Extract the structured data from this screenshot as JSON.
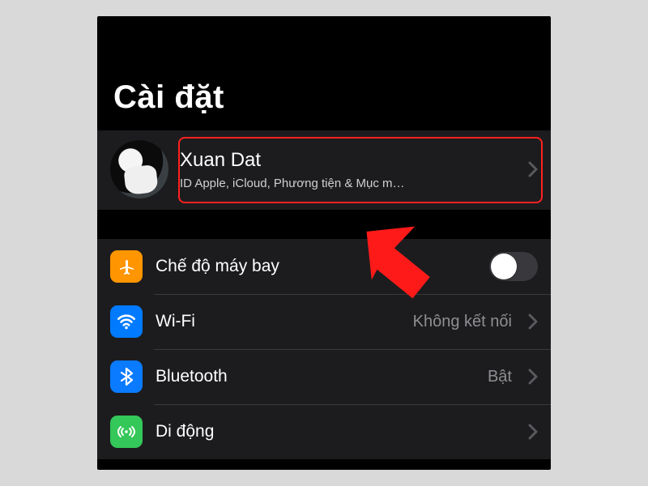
{
  "title": "Cài đặt",
  "profile": {
    "name": "Xuan Dat",
    "subtitle": "ID Apple, iCloud, Phương tiện & Mục m…"
  },
  "rows": {
    "airplane": {
      "label": "Chế độ máy bay",
      "switch_on": false
    },
    "wifi": {
      "label": "Wi-Fi",
      "detail": "Không kết nối"
    },
    "bluetooth": {
      "label": "Bluetooth",
      "detail": "Bật"
    },
    "cellular": {
      "label": "Di động"
    }
  },
  "colors": {
    "airplane": "#ff9500",
    "wifi": "#007aff",
    "bluetooth": "#0a7aff",
    "cellular": "#34c759",
    "highlight": "#ff2020"
  }
}
